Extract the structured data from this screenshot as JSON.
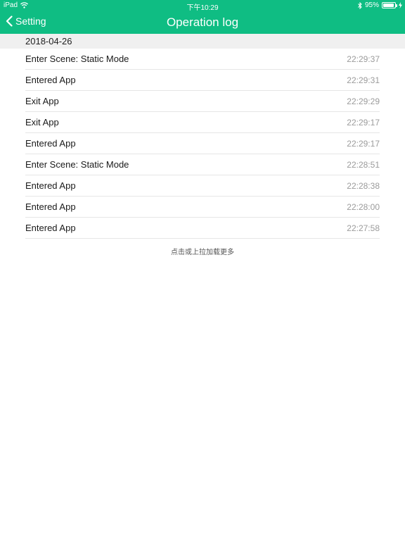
{
  "status_bar": {
    "device": "iPad",
    "time": "下午10:29",
    "battery_text": "95%",
    "battery_level": 0.95,
    "icons": [
      "wifi-icon",
      "bluetooth-icon",
      "battery-icon",
      "charging-icon"
    ]
  },
  "navbar": {
    "back_label": "Setting",
    "title": "Operation log",
    "color": "#0fbd83"
  },
  "log": {
    "date": "2018-04-26",
    "entries": [
      {
        "event": "Enter Scene: Static Mode",
        "time": "22:29:37"
      },
      {
        "event": "Entered App",
        "time": "22:29:31"
      },
      {
        "event": "Exit App",
        "time": "22:29:29"
      },
      {
        "event": "Exit App",
        "time": "22:29:17"
      },
      {
        "event": "Entered App",
        "time": "22:29:17"
      },
      {
        "event": "Enter Scene: Static Mode",
        "time": "22:28:51"
      },
      {
        "event": "Entered App",
        "time": "22:28:38"
      },
      {
        "event": "Entered App",
        "time": "22:28:00"
      },
      {
        "event": "Entered App",
        "time": "22:27:58"
      }
    ]
  },
  "footer": {
    "load_more": "点击或上拉加载更多"
  }
}
